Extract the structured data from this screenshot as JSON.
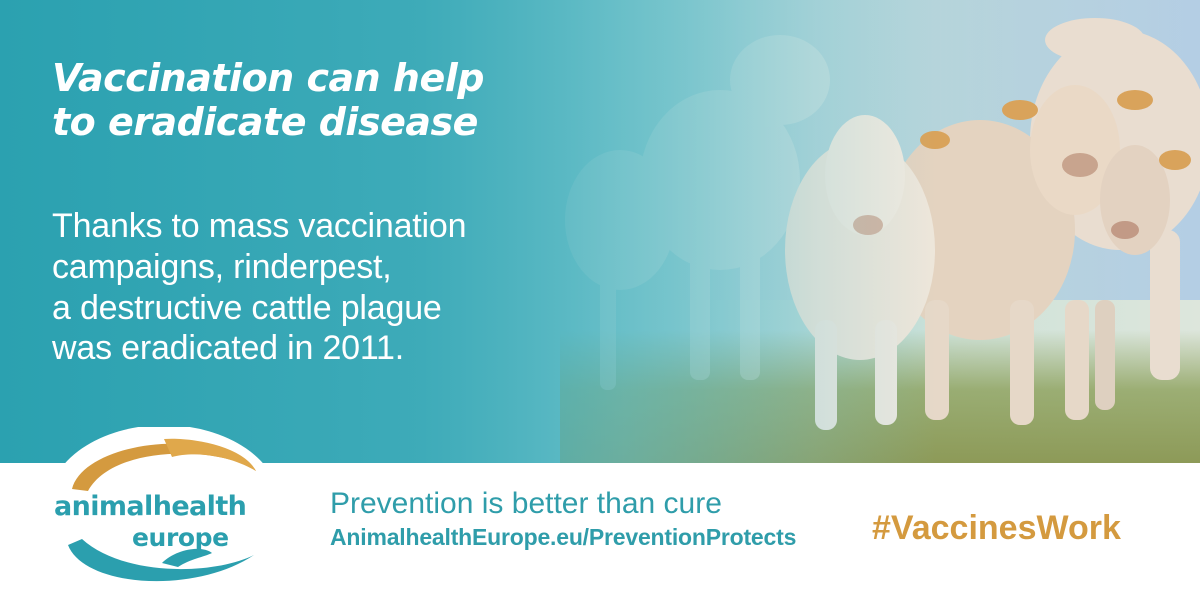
{
  "hero": {
    "headline": "Vaccination can help\nto eradicate disease",
    "body": "Thanks to mass vaccination\ncampaigns, rinderpest,\na destructive cattle plague\nwas eradicated in 2011.",
    "image_subject": "herd-of-cattle-photo"
  },
  "footer": {
    "logo_line1": "animalhealth",
    "logo_line2": "europe",
    "tagline": "Prevention is better than cure",
    "url": "AnimalhealthEurope.eu/PreventionProtects",
    "hashtag": "#VaccinesWork"
  },
  "colors": {
    "brand_teal": "#2b9fae",
    "accent_orange": "#d49a3f",
    "background_white": "#ffffff"
  }
}
